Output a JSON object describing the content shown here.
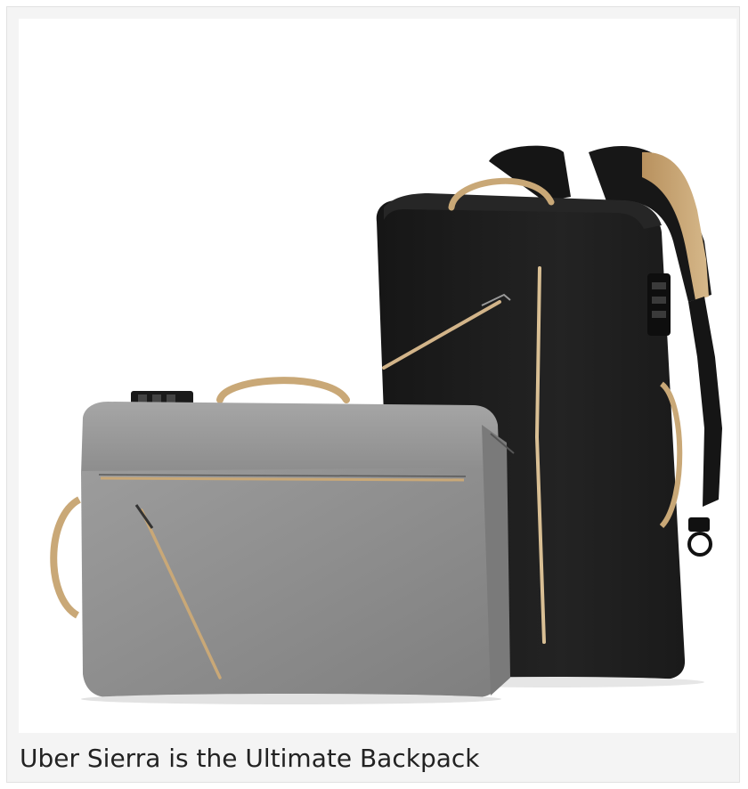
{
  "figure": {
    "caption": "Uber Sierra is the Ultimate Backpack",
    "image_description_name": "backpack-product-photo"
  },
  "colors": {
    "frame_background": "#f4f4f4",
    "frame_border": "#e2e2e2",
    "caption_text": "#222222",
    "black_bag": "#1c1c1c",
    "grey_bag": "#8e8e8e",
    "tan_accent": "#c9a877"
  }
}
